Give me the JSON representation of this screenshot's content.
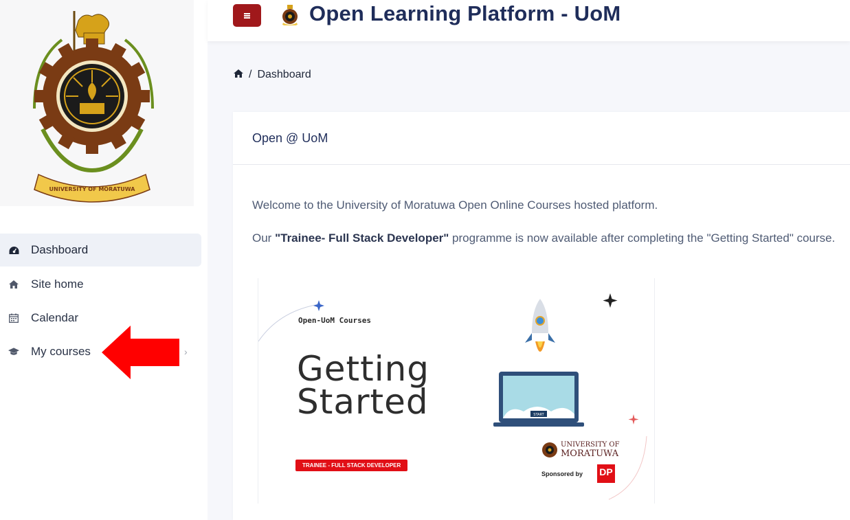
{
  "app": {
    "title": "Open Learning Platform - UoM"
  },
  "sidebar": {
    "logo_text": "UNIVERSITY OF MORATUWA",
    "items": [
      {
        "label": "Dashboard",
        "icon": "dashboard-icon",
        "active": true
      },
      {
        "label": "Site home",
        "icon": "home-icon",
        "active": false
      },
      {
        "label": "Calendar",
        "icon": "calendar-icon",
        "active": false
      },
      {
        "label": "My courses",
        "icon": "graduation-cap-icon",
        "active": false,
        "has_chevron": true
      }
    ]
  },
  "breadcrumb": {
    "items": [
      "Dashboard"
    ]
  },
  "card": {
    "title": "Open @ UoM",
    "welcome": "Welcome to the University of Moratuwa Open Online Courses hosted platform.",
    "programme_prefix": "Our ",
    "programme_name": "\"Trainee- Full Stack Developer\"",
    "programme_suffix": " programme is now available after completing the \"Getting Started\" course.",
    "banner": {
      "kicker": "Open-UoM Courses",
      "title_line1": "Getting",
      "title_line2": "Started",
      "badge": "TRAINEE - FULL STACK DEVELOPER",
      "laptop_label": "START",
      "uni_line1": "UNIVERSITY OF",
      "uni_line2": "MORATUWA",
      "sponsor": "Sponsored by",
      "sponsor_logo": "DP"
    }
  },
  "colors": {
    "accent": "#a0181b",
    "title": "#1f2d5a",
    "arrow": "#ff0000",
    "badge": "#e10f16"
  }
}
